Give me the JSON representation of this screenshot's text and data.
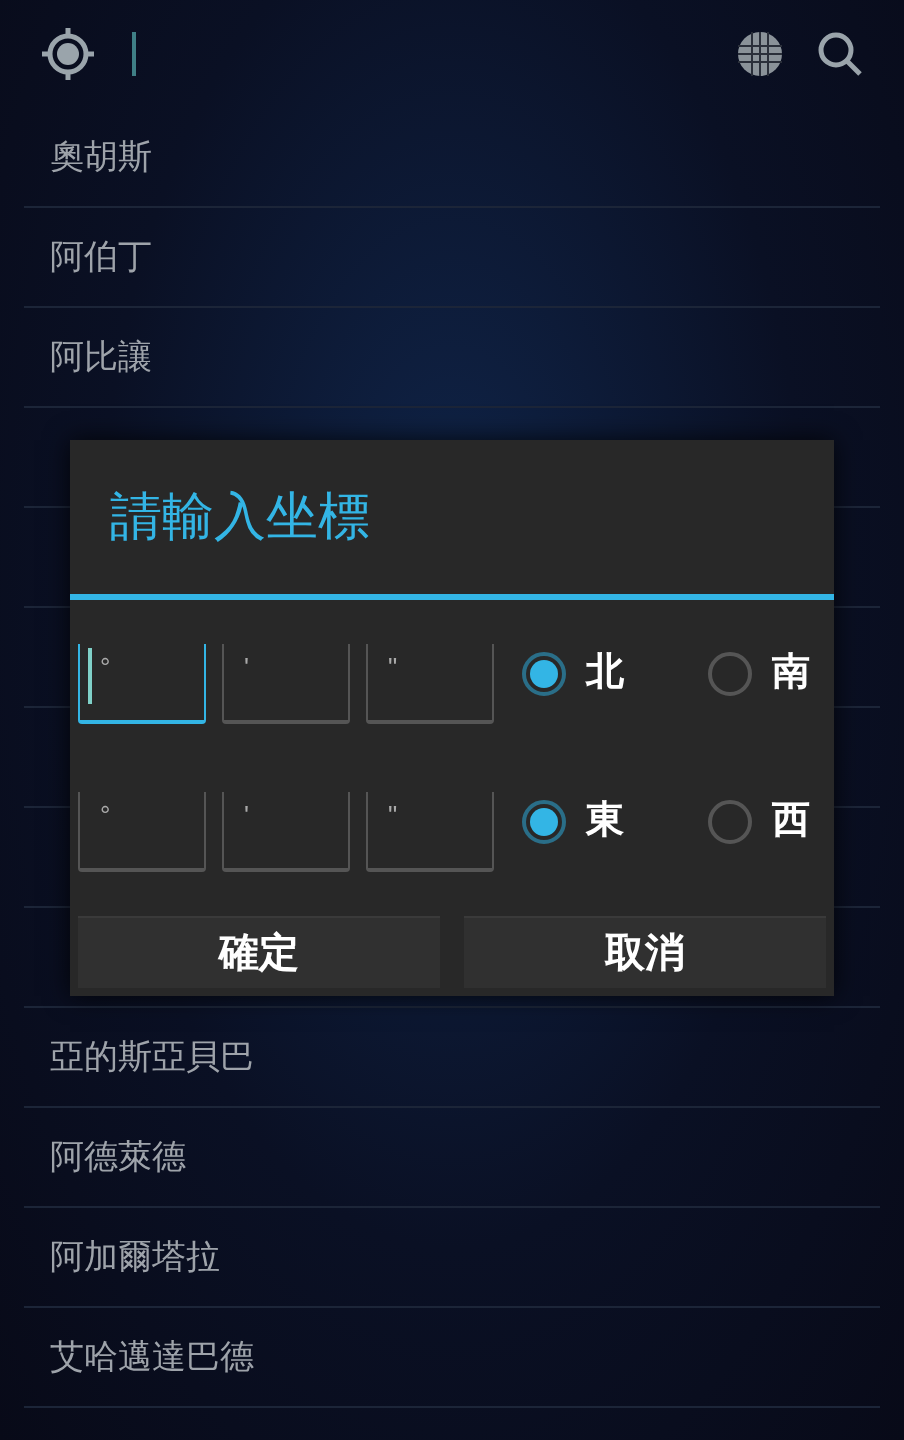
{
  "rows_above": [
    {
      "text": "奧胡斯"
    },
    {
      "text": "阿伯丁"
    },
    {
      "text": "阿比讓"
    }
  ],
  "rows_below": [
    {
      "text": "亞的斯亞貝巴"
    },
    {
      "text": "阿德萊德"
    },
    {
      "text": "阿加爾塔拉"
    },
    {
      "text": "艾哈邁達巴德"
    }
  ],
  "dialog": {
    "title": "請輸入坐標",
    "coordinates": [
      {
        "fields": [
          {
            "placeholder": "°",
            "focused": true
          },
          {
            "placeholder": "'",
            "focused": false
          },
          {
            "placeholder": "\"",
            "focused": false
          }
        ],
        "options": [
          {
            "label": "北",
            "selected": true
          },
          {
            "label": "南",
            "selected": false
          }
        ]
      },
      {
        "fields": [
          {
            "placeholder": "°",
            "focused": false
          },
          {
            "placeholder": "'",
            "focused": false
          },
          {
            "placeholder": "\"",
            "focused": false
          }
        ],
        "options": [
          {
            "label": "東",
            "selected": true
          },
          {
            "label": "西",
            "selected": false
          }
        ]
      }
    ],
    "buttons": [
      "確定",
      "取消"
    ]
  }
}
